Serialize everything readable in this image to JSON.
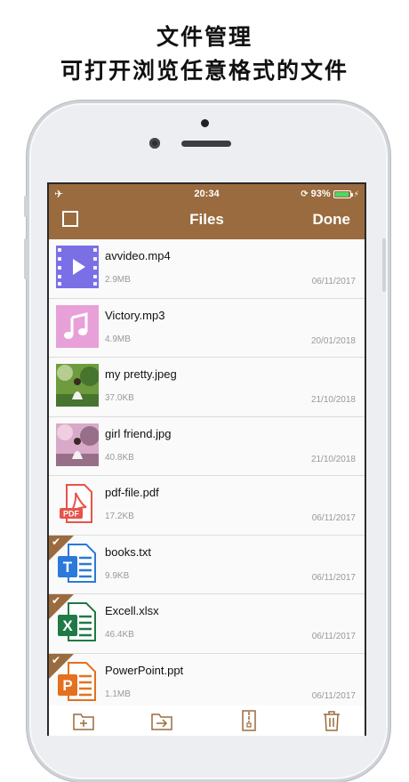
{
  "headline": {
    "line1": "文件管理",
    "line2": "可打开浏览任意格式的文件"
  },
  "status": {
    "time": "20:34",
    "battery": "93%",
    "battery_level": 0.93
  },
  "nav": {
    "title": "Files",
    "done": "Done"
  },
  "files": [
    {
      "name": "avvideo.mp4",
      "size": "2.9MB",
      "date": "06/11/2017",
      "icon": "video-icon",
      "checked": false
    },
    {
      "name": "Victory.mp3",
      "size": "4.9MB",
      "date": "20/01/2018",
      "icon": "music-icon",
      "checked": false
    },
    {
      "name": "my pretty.jpeg",
      "size": "37.0KB",
      "date": "21/10/2018",
      "icon": "photo-thumbnail",
      "checked": false
    },
    {
      "name": "girl friend.jpg",
      "size": "40.8KB",
      "date": "21/10/2018",
      "icon": "photo-thumbnail",
      "checked": false
    },
    {
      "name": "pdf-file.pdf",
      "size": "17.2KB",
      "date": "06/11/2017",
      "icon": "pdf-icon",
      "checked": false
    },
    {
      "name": "books.txt",
      "size": "9.9KB",
      "date": "06/11/2017",
      "icon": "text-doc-icon",
      "checked": true
    },
    {
      "name": "Excell.xlsx",
      "size": "46.4KB",
      "date": "06/11/2017",
      "icon": "excel-icon",
      "checked": true
    },
    {
      "name": "PowerPoint.ppt",
      "size": "1.1MB",
      "date": "06/11/2017",
      "icon": "powerpoint-icon",
      "checked": true
    }
  ],
  "icon_labels": {
    "pdf": "PDF",
    "txt": "T",
    "xls": "X",
    "ppt": "P"
  },
  "colors": {
    "accent": "#9a6b3e",
    "video": "#7b6fe6",
    "music": "#e8a0d8",
    "pdf": "#e8534a",
    "txt": "#2b79d8",
    "xls": "#1f7a45",
    "ppt": "#e5701f"
  }
}
